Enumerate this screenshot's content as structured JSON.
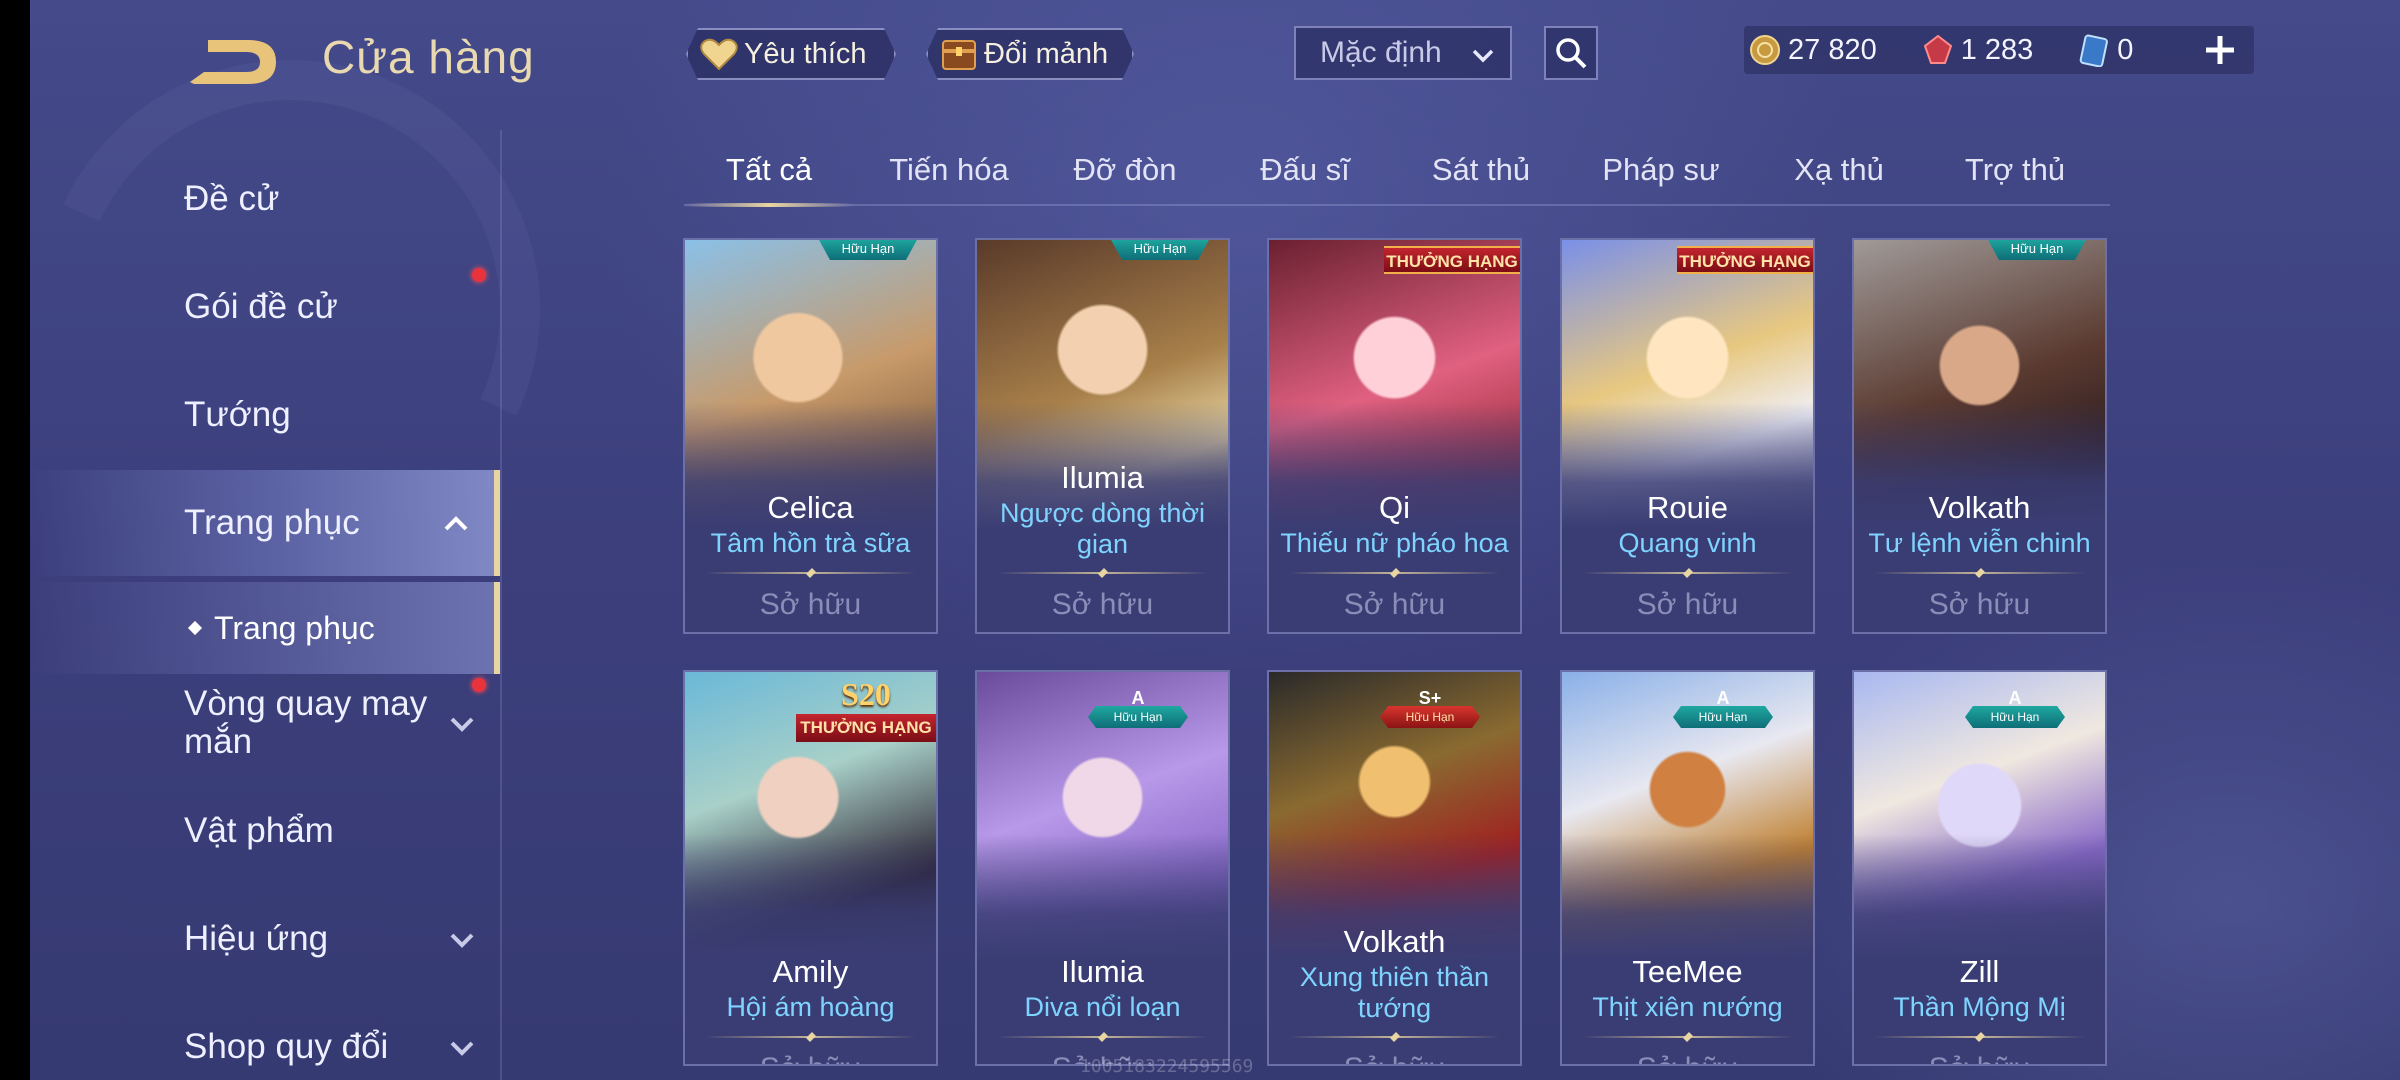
{
  "header": {
    "title": "Cửa hàng"
  },
  "sidebar": {
    "items": [
      {
        "label": "Đề cử",
        "badge": false
      },
      {
        "label": "Gói đề cử",
        "badge": true
      },
      {
        "label": "Tướng",
        "badge": false
      },
      {
        "label": "Trang phục",
        "expanded": true
      },
      {
        "label": "Vòng quay may mắn",
        "badge": true
      },
      {
        "label": "Vật phẩm"
      },
      {
        "label": "Hiệu ứng"
      },
      {
        "label": "Shop quy đổi"
      }
    ],
    "sub_item": {
      "label": "Trang phục"
    }
  },
  "topbar": {
    "favorite_label": "Yêu thích",
    "exchange_label": "Đổi mảnh",
    "sort_value": "Mặc định",
    "currencies": [
      {
        "icon": "gold-coin-icon",
        "value": "27 820"
      },
      {
        "icon": "ruby-icon",
        "value": "1 283"
      },
      {
        "icon": "voucher-card-icon",
        "value": "0"
      }
    ]
  },
  "tabs": [
    "Tất cả",
    "Tiến hóa",
    "Đỡ đòn",
    "Đấu sĩ",
    "Sát thủ",
    "Pháp sư",
    "Xạ thủ",
    "Trợ thủ"
  ],
  "active_tab": "Tất cả",
  "cards": [
    {
      "hero": "Celica",
      "skin": "Tâm hồn trà sữa",
      "status": "Sở hữu",
      "badge": "Hữu Hạn",
      "badge_type": "limited"
    },
    {
      "hero": "Ilumia",
      "skin": "Ngược dòng thời gian",
      "status": "Sở hữu",
      "badge": "Hữu Hạn",
      "badge_type": "limited"
    },
    {
      "hero": "Qi",
      "skin": "Thiếu nữ pháo hoa",
      "status": "Sở hữu",
      "badge": "THƯỞNG HẠNG",
      "badge_type": "ranked"
    },
    {
      "hero": "Rouie",
      "skin": "Quang vinh",
      "status": "Sở hữu",
      "badge": "THƯỞNG HẠNG",
      "badge_type": "ranked"
    },
    {
      "hero": "Volkath",
      "skin": "Tư lệnh viễn chinh",
      "status": "Sở hữu",
      "badge": "Hữu Hạn",
      "badge_type": "limited"
    },
    {
      "hero": "Amily",
      "skin": "Hội ám hoàng",
      "status": "Sở hữu",
      "badge": "THƯỞNG HẠNG",
      "badge_top": "S20",
      "badge_type": "s20"
    },
    {
      "hero": "Ilumia",
      "skin": "Diva nổi loạn",
      "status": "Sở hữu",
      "badge": "Hữu Hạn",
      "badge_top": "A",
      "badge_type": "grade"
    },
    {
      "hero": "Volkath",
      "skin": "Xung thiên thần tướng",
      "status": "Sở hữu",
      "badge": "Hữu Hạn",
      "badge_top": "S+",
      "badge_type": "grade-gold"
    },
    {
      "hero": "TeeMee",
      "skin": "Thịt xiên nướng",
      "status": "Sở hữu",
      "badge": "Hữu Hạn",
      "badge_top": "A",
      "badge_type": "grade"
    },
    {
      "hero": "Zill",
      "skin": "Thần Mộng Mị",
      "status": "Sở hữu",
      "badge": "Hữu Hạn",
      "badge_top": "A",
      "badge_type": "grade"
    }
  ],
  "watermark": "1005183224595569",
  "colors": {
    "accent_gold": "#e8d6a2",
    "skin_name": "#7fd4ff",
    "notification": "#e8323c"
  }
}
